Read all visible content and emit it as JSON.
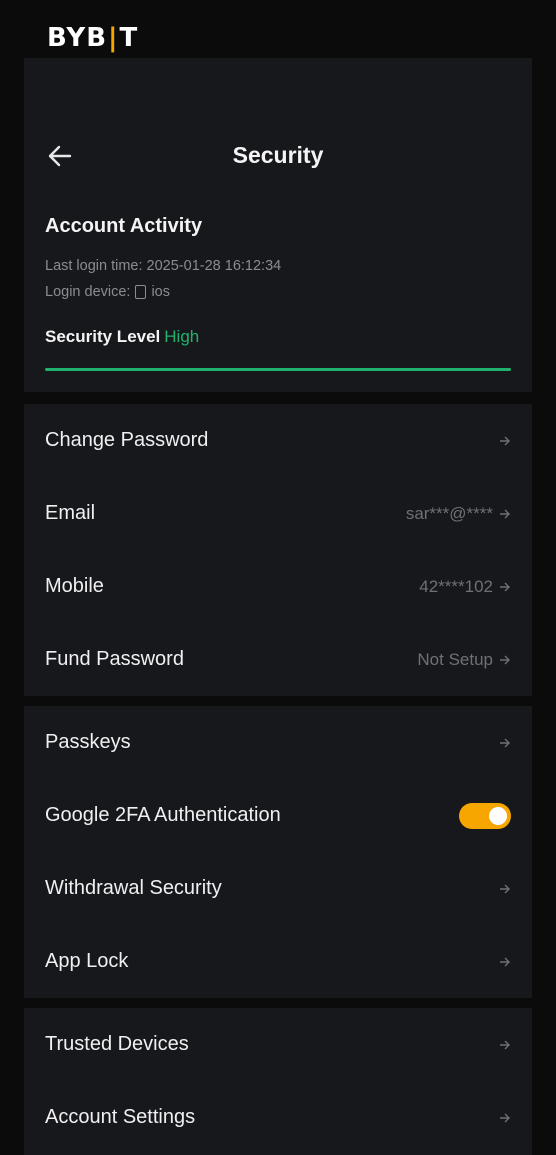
{
  "brand": {
    "logo_left": "BYB",
    "logo_bar": "|",
    "logo_right": "T",
    "accent": "#f7a600"
  },
  "header": {
    "title": "Security",
    "back_icon": "arrow-left-icon"
  },
  "account_activity": {
    "title": "Account Activity",
    "last_login": "Last login time: 2025-01-28 16:12:34",
    "device_label": "Login device:",
    "device_value": "ios",
    "security_level_label": "Security Level",
    "security_level_value": "High",
    "security_level_color": "#20b26c"
  },
  "group_a": [
    {
      "label": "Change Password",
      "value": ""
    },
    {
      "label": "Email",
      "value": "sar***@****"
    },
    {
      "label": "Mobile",
      "value": "42****102"
    },
    {
      "label": "Fund Password",
      "value": "Not Setup"
    }
  ],
  "group_b": [
    {
      "label": "Passkeys",
      "value": ""
    },
    {
      "label": "Google 2FA Authentication",
      "toggle": true
    },
    {
      "label": "Withdrawal Security",
      "value": ""
    },
    {
      "label": "App Lock",
      "value": ""
    }
  ],
  "group_c": [
    {
      "label": "Trusted Devices",
      "value": ""
    },
    {
      "label": "Account Settings",
      "value": ""
    }
  ]
}
